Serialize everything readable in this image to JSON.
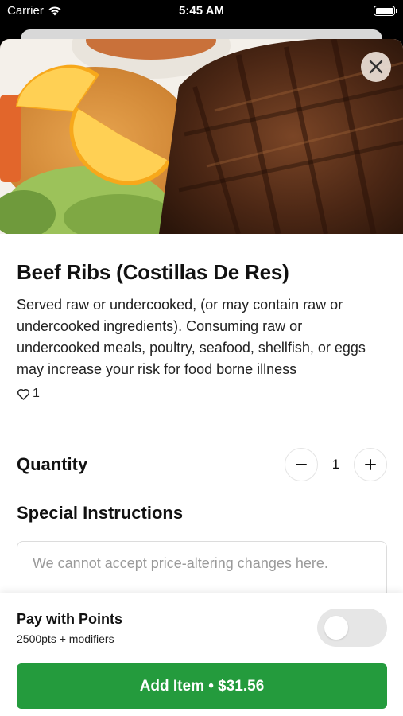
{
  "status_bar": {
    "carrier": "Carrier",
    "time": "5:45 AM"
  },
  "item": {
    "title": "Beef Ribs (Costillas De Res)",
    "description": "Served raw or undercooked, (or may contain raw or undercooked ingredients). Consuming raw or undercooked meals, poultry, seafood, shellfish, or eggs may increase your risk for food borne illness",
    "likes": "1"
  },
  "quantity": {
    "label": "Quantity",
    "value": "1"
  },
  "special_instructions": {
    "label": "Special Instructions",
    "placeholder": "We cannot accept price-altering changes here."
  },
  "footer": {
    "points_title": "Pay with Points",
    "points_subtitle": "2500pts + modifiers",
    "points_enabled": false,
    "add_button": "Add Item • $31.56"
  },
  "colors": {
    "accent_green": "#249b3d",
    "toggle_off": "#e6e6e6"
  },
  "icons": [
    "wifi-icon",
    "battery-icon",
    "close-icon",
    "heart-icon",
    "minus-icon",
    "plus-icon"
  ]
}
